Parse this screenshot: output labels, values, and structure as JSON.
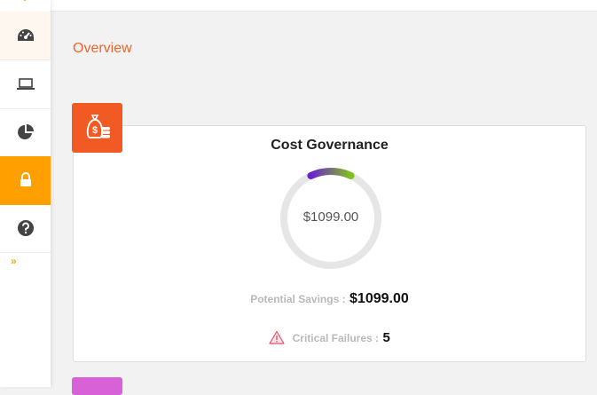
{
  "page": {
    "title": "Overview"
  },
  "sidebar": {
    "items": [
      {
        "name": "dashboard",
        "icon": "speedometer-icon",
        "active": false
      },
      {
        "name": "devices",
        "icon": "laptop-icon",
        "active": false
      },
      {
        "name": "reports",
        "icon": "pie-chart-icon",
        "active": false
      },
      {
        "name": "security",
        "icon": "lock-icon",
        "active": true
      },
      {
        "name": "help",
        "icon": "question-icon",
        "active": false
      }
    ],
    "expand_label": "»"
  },
  "card": {
    "icon": "money-bag-coins-icon",
    "title": "Cost Governance",
    "gauge_value": "$1099.00",
    "gauge_fill_fraction": 0.14,
    "gauge_colors": [
      "#6a1fd1",
      "#7fc31c"
    ],
    "savings_label": "Potential Savings :",
    "savings_value": "$1099.00",
    "failures_label": "Critical Failures :",
    "failures_value": "5"
  },
  "colors": {
    "accent": "#f15a22",
    "active_nav": "#ffa000",
    "next_card": "#d861d8"
  }
}
